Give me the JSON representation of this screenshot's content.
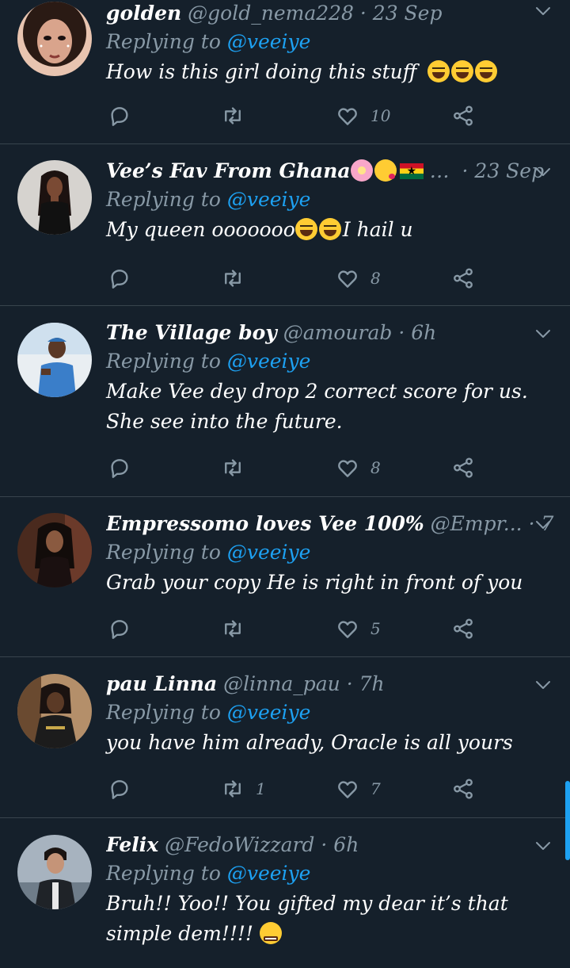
{
  "reply_prefix": "Replying to",
  "tweets": [
    {
      "name": "golden",
      "handle": "@gold_nema228",
      "time": "· 23 Sep",
      "replying_to": "@veeiye",
      "text_lines": [
        "How is this girl doing this stuff"
      ],
      "emoji_tail": [
        "tears-of-joy",
        "tears-of-joy",
        "tears-of-joy"
      ],
      "retweets": "",
      "likes": "10"
    },
    {
      "name": "Vee’s Fav From Ghana",
      "handle": "…",
      "time": "· 23 Sep",
      "replying_to": "@veeiye",
      "text_lines": [
        "My queen ooooooo",
        "I hail u"
      ],
      "retweets": "",
      "likes": "8"
    },
    {
      "name": "The Village boy",
      "handle": "@amourab",
      "time": "· 6h",
      "replying_to": "@veeiye",
      "text_lines": [
        "Make Vee dey drop 2 correct score for us.",
        "She see into the future."
      ],
      "retweets": "",
      "likes": "8"
    },
    {
      "name": "Empressomo loves Vee 100%",
      "handle": "@Empr...",
      "time": "· 7h",
      "replying_to": "@veeiye",
      "text_lines": [
        "Grab your copy He is right in front of you"
      ],
      "retweets": "",
      "likes": "5"
    },
    {
      "name": "pau Linna",
      "handle": "@linna_pau",
      "time": "· 7h",
      "replying_to": "@veeiye",
      "text_lines": [
        "you have him already, Oracle is all yours"
      ],
      "retweets": "1",
      "likes": "7"
    },
    {
      "name": "Felix",
      "handle": "@FedoWizzard",
      "time": "· 6h",
      "replying_to": "@veeiye",
      "text_lines": [
        "Bruh!! Yoo!! You gifted my dear it’s that",
        "simple dem!!!!"
      ],
      "retweets": "",
      "likes": ""
    }
  ],
  "colors": {
    "background": "#15202b",
    "divider": "#38444d",
    "muted": "#8899a6",
    "link": "#1da1f2",
    "text": "#ffffff"
  },
  "icons": [
    "reply-icon",
    "retweet-icon",
    "like-icon",
    "share-icon",
    "chevron-down-icon"
  ]
}
